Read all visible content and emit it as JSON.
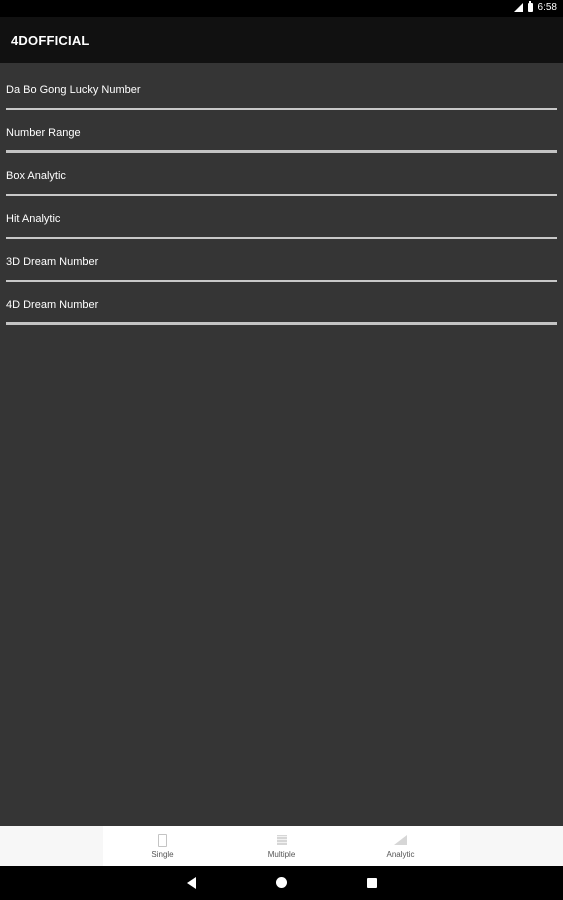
{
  "status_bar": {
    "time": "6:58",
    "icons": [
      "signal-icon",
      "battery-icon"
    ]
  },
  "app_bar": {
    "title": "4DOFFICIAL"
  },
  "menu": {
    "items": [
      {
        "label": "Da Bo Gong Lucky Number"
      },
      {
        "label": "Number Range"
      },
      {
        "label": "Box Analytic"
      },
      {
        "label": "Hit Analytic"
      },
      {
        "label": "3D Dream Number"
      },
      {
        "label": "4D Dream Number"
      }
    ]
  },
  "bottom_nav": {
    "tabs": [
      {
        "label": "Single",
        "icon": "phone-icon"
      },
      {
        "label": "Multiple",
        "icon": "grid-icon"
      },
      {
        "label": "Analytic",
        "icon": "chart-icon"
      }
    ]
  },
  "system_nav": {
    "icons": [
      "back-icon",
      "home-icon",
      "recents-icon"
    ]
  }
}
